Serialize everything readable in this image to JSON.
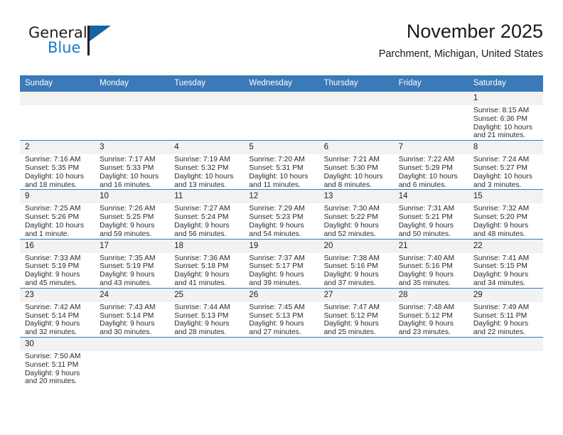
{
  "brand": {
    "name_top": "General",
    "name_bottom": "Blue",
    "accent_color": "#1e78c8",
    "triangle_color": "#1364a5"
  },
  "header": {
    "title": "November 2025",
    "subtitle": "Parchment, Michigan, United States"
  },
  "theme": {
    "header_row_bg": "#3a7ab8",
    "daynum_bg": "#f2f2f2",
    "grid_line": "#3a7ab8",
    "text": "#2b2b2b"
  },
  "weekday_headers": [
    "Sunday",
    "Monday",
    "Tuesday",
    "Wednesday",
    "Thursday",
    "Friday",
    "Saturday"
  ],
  "labels": {
    "sunrise_prefix": "Sunrise:",
    "sunset_prefix": "Sunset:",
    "daylight_prefix": "Daylight:"
  },
  "weeks": [
    [
      {
        "blank": true
      },
      {
        "blank": true
      },
      {
        "blank": true
      },
      {
        "blank": true
      },
      {
        "blank": true
      },
      {
        "blank": true
      },
      {
        "day": "1",
        "sunrise": "Sunrise: 8:15 AM",
        "sunset": "Sunset: 6:36 PM",
        "daylight1": "Daylight: 10 hours",
        "daylight2": "and 21 minutes."
      }
    ],
    [
      {
        "day": "2",
        "sunrise": "Sunrise: 7:16 AM",
        "sunset": "Sunset: 5:35 PM",
        "daylight1": "Daylight: 10 hours",
        "daylight2": "and 18 minutes."
      },
      {
        "day": "3",
        "sunrise": "Sunrise: 7:17 AM",
        "sunset": "Sunset: 5:33 PM",
        "daylight1": "Daylight: 10 hours",
        "daylight2": "and 16 minutes."
      },
      {
        "day": "4",
        "sunrise": "Sunrise: 7:19 AM",
        "sunset": "Sunset: 5:32 PM",
        "daylight1": "Daylight: 10 hours",
        "daylight2": "and 13 minutes."
      },
      {
        "day": "5",
        "sunrise": "Sunrise: 7:20 AM",
        "sunset": "Sunset: 5:31 PM",
        "daylight1": "Daylight: 10 hours",
        "daylight2": "and 11 minutes."
      },
      {
        "day": "6",
        "sunrise": "Sunrise: 7:21 AM",
        "sunset": "Sunset: 5:30 PM",
        "daylight1": "Daylight: 10 hours",
        "daylight2": "and 8 minutes."
      },
      {
        "day": "7",
        "sunrise": "Sunrise: 7:22 AM",
        "sunset": "Sunset: 5:29 PM",
        "daylight1": "Daylight: 10 hours",
        "daylight2": "and 6 minutes."
      },
      {
        "day": "8",
        "sunrise": "Sunrise: 7:24 AM",
        "sunset": "Sunset: 5:27 PM",
        "daylight1": "Daylight: 10 hours",
        "daylight2": "and 3 minutes."
      }
    ],
    [
      {
        "day": "9",
        "sunrise": "Sunrise: 7:25 AM",
        "sunset": "Sunset: 5:26 PM",
        "daylight1": "Daylight: 10 hours",
        "daylight2": "and 1 minute."
      },
      {
        "day": "10",
        "sunrise": "Sunrise: 7:26 AM",
        "sunset": "Sunset: 5:25 PM",
        "daylight1": "Daylight: 9 hours",
        "daylight2": "and 59 minutes."
      },
      {
        "day": "11",
        "sunrise": "Sunrise: 7:27 AM",
        "sunset": "Sunset: 5:24 PM",
        "daylight1": "Daylight: 9 hours",
        "daylight2": "and 56 minutes."
      },
      {
        "day": "12",
        "sunrise": "Sunrise: 7:29 AM",
        "sunset": "Sunset: 5:23 PM",
        "daylight1": "Daylight: 9 hours",
        "daylight2": "and 54 minutes."
      },
      {
        "day": "13",
        "sunrise": "Sunrise: 7:30 AM",
        "sunset": "Sunset: 5:22 PM",
        "daylight1": "Daylight: 9 hours",
        "daylight2": "and 52 minutes."
      },
      {
        "day": "14",
        "sunrise": "Sunrise: 7:31 AM",
        "sunset": "Sunset: 5:21 PM",
        "daylight1": "Daylight: 9 hours",
        "daylight2": "and 50 minutes."
      },
      {
        "day": "15",
        "sunrise": "Sunrise: 7:32 AM",
        "sunset": "Sunset: 5:20 PM",
        "daylight1": "Daylight: 9 hours",
        "daylight2": "and 48 minutes."
      }
    ],
    [
      {
        "day": "16",
        "sunrise": "Sunrise: 7:33 AM",
        "sunset": "Sunset: 5:19 PM",
        "daylight1": "Daylight: 9 hours",
        "daylight2": "and 45 minutes."
      },
      {
        "day": "17",
        "sunrise": "Sunrise: 7:35 AM",
        "sunset": "Sunset: 5:19 PM",
        "daylight1": "Daylight: 9 hours",
        "daylight2": "and 43 minutes."
      },
      {
        "day": "18",
        "sunrise": "Sunrise: 7:36 AM",
        "sunset": "Sunset: 5:18 PM",
        "daylight1": "Daylight: 9 hours",
        "daylight2": "and 41 minutes."
      },
      {
        "day": "19",
        "sunrise": "Sunrise: 7:37 AM",
        "sunset": "Sunset: 5:17 PM",
        "daylight1": "Daylight: 9 hours",
        "daylight2": "and 39 minutes."
      },
      {
        "day": "20",
        "sunrise": "Sunrise: 7:38 AM",
        "sunset": "Sunset: 5:16 PM",
        "daylight1": "Daylight: 9 hours",
        "daylight2": "and 37 minutes."
      },
      {
        "day": "21",
        "sunrise": "Sunrise: 7:40 AM",
        "sunset": "Sunset: 5:16 PM",
        "daylight1": "Daylight: 9 hours",
        "daylight2": "and 35 minutes."
      },
      {
        "day": "22",
        "sunrise": "Sunrise: 7:41 AM",
        "sunset": "Sunset: 5:15 PM",
        "daylight1": "Daylight: 9 hours",
        "daylight2": "and 34 minutes."
      }
    ],
    [
      {
        "day": "23",
        "sunrise": "Sunrise: 7:42 AM",
        "sunset": "Sunset: 5:14 PM",
        "daylight1": "Daylight: 9 hours",
        "daylight2": "and 32 minutes."
      },
      {
        "day": "24",
        "sunrise": "Sunrise: 7:43 AM",
        "sunset": "Sunset: 5:14 PM",
        "daylight1": "Daylight: 9 hours",
        "daylight2": "and 30 minutes."
      },
      {
        "day": "25",
        "sunrise": "Sunrise: 7:44 AM",
        "sunset": "Sunset: 5:13 PM",
        "daylight1": "Daylight: 9 hours",
        "daylight2": "and 28 minutes."
      },
      {
        "day": "26",
        "sunrise": "Sunrise: 7:45 AM",
        "sunset": "Sunset: 5:13 PM",
        "daylight1": "Daylight: 9 hours",
        "daylight2": "and 27 minutes."
      },
      {
        "day": "27",
        "sunrise": "Sunrise: 7:47 AM",
        "sunset": "Sunset: 5:12 PM",
        "daylight1": "Daylight: 9 hours",
        "daylight2": "and 25 minutes."
      },
      {
        "day": "28",
        "sunrise": "Sunrise: 7:48 AM",
        "sunset": "Sunset: 5:12 PM",
        "daylight1": "Daylight: 9 hours",
        "daylight2": "and 23 minutes."
      },
      {
        "day": "29",
        "sunrise": "Sunrise: 7:49 AM",
        "sunset": "Sunset: 5:11 PM",
        "daylight1": "Daylight: 9 hours",
        "daylight2": "and 22 minutes."
      }
    ],
    [
      {
        "day": "30",
        "sunrise": "Sunrise: 7:50 AM",
        "sunset": "Sunset: 5:11 PM",
        "daylight1": "Daylight: 9 hours",
        "daylight2": "and 20 minutes."
      },
      {
        "blank": true
      },
      {
        "blank": true
      },
      {
        "blank": true
      },
      {
        "blank": true
      },
      {
        "blank": true
      },
      {
        "blank": true
      }
    ]
  ]
}
